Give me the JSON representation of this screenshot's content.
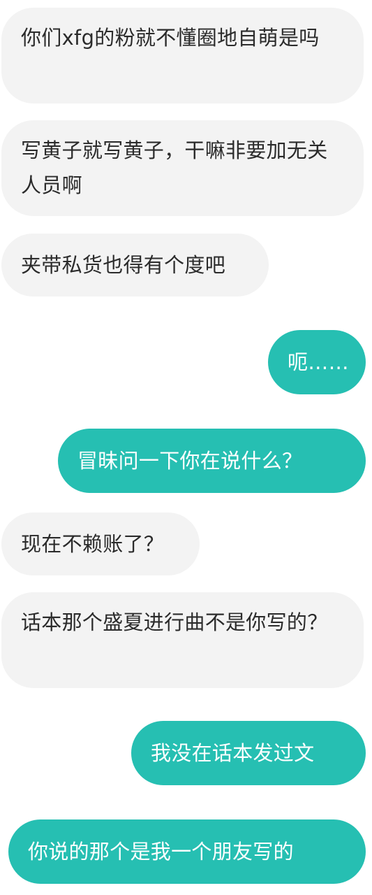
{
  "messages": [
    {
      "side": "incoming",
      "text": "你们xfg的粉就不懂圈地自萌是吗"
    },
    {
      "side": "incoming",
      "text": "写黄子就写黄子，干嘛非要加无关人员啊"
    },
    {
      "side": "incoming",
      "text": "夹带私货也得有个度吧"
    },
    {
      "side": "outgoing",
      "text": "呃……"
    },
    {
      "side": "outgoing",
      "text": "冒昧问一下你在说什么？"
    },
    {
      "side": "incoming",
      "text": "现在不赖账了？"
    },
    {
      "side": "incoming",
      "text": "话本那个盛夏进行曲不是你写的？"
    },
    {
      "side": "outgoing",
      "text": "我没在话本发过文"
    },
    {
      "side": "outgoing",
      "text": "你说的那个是我一个朋友写的"
    }
  ],
  "colors": {
    "incoming_bubble": "#f3f3f3",
    "outgoing_bubble": "#26bfb2",
    "incoming_text": "#2b2b2b",
    "outgoing_text": "#ffffff"
  }
}
